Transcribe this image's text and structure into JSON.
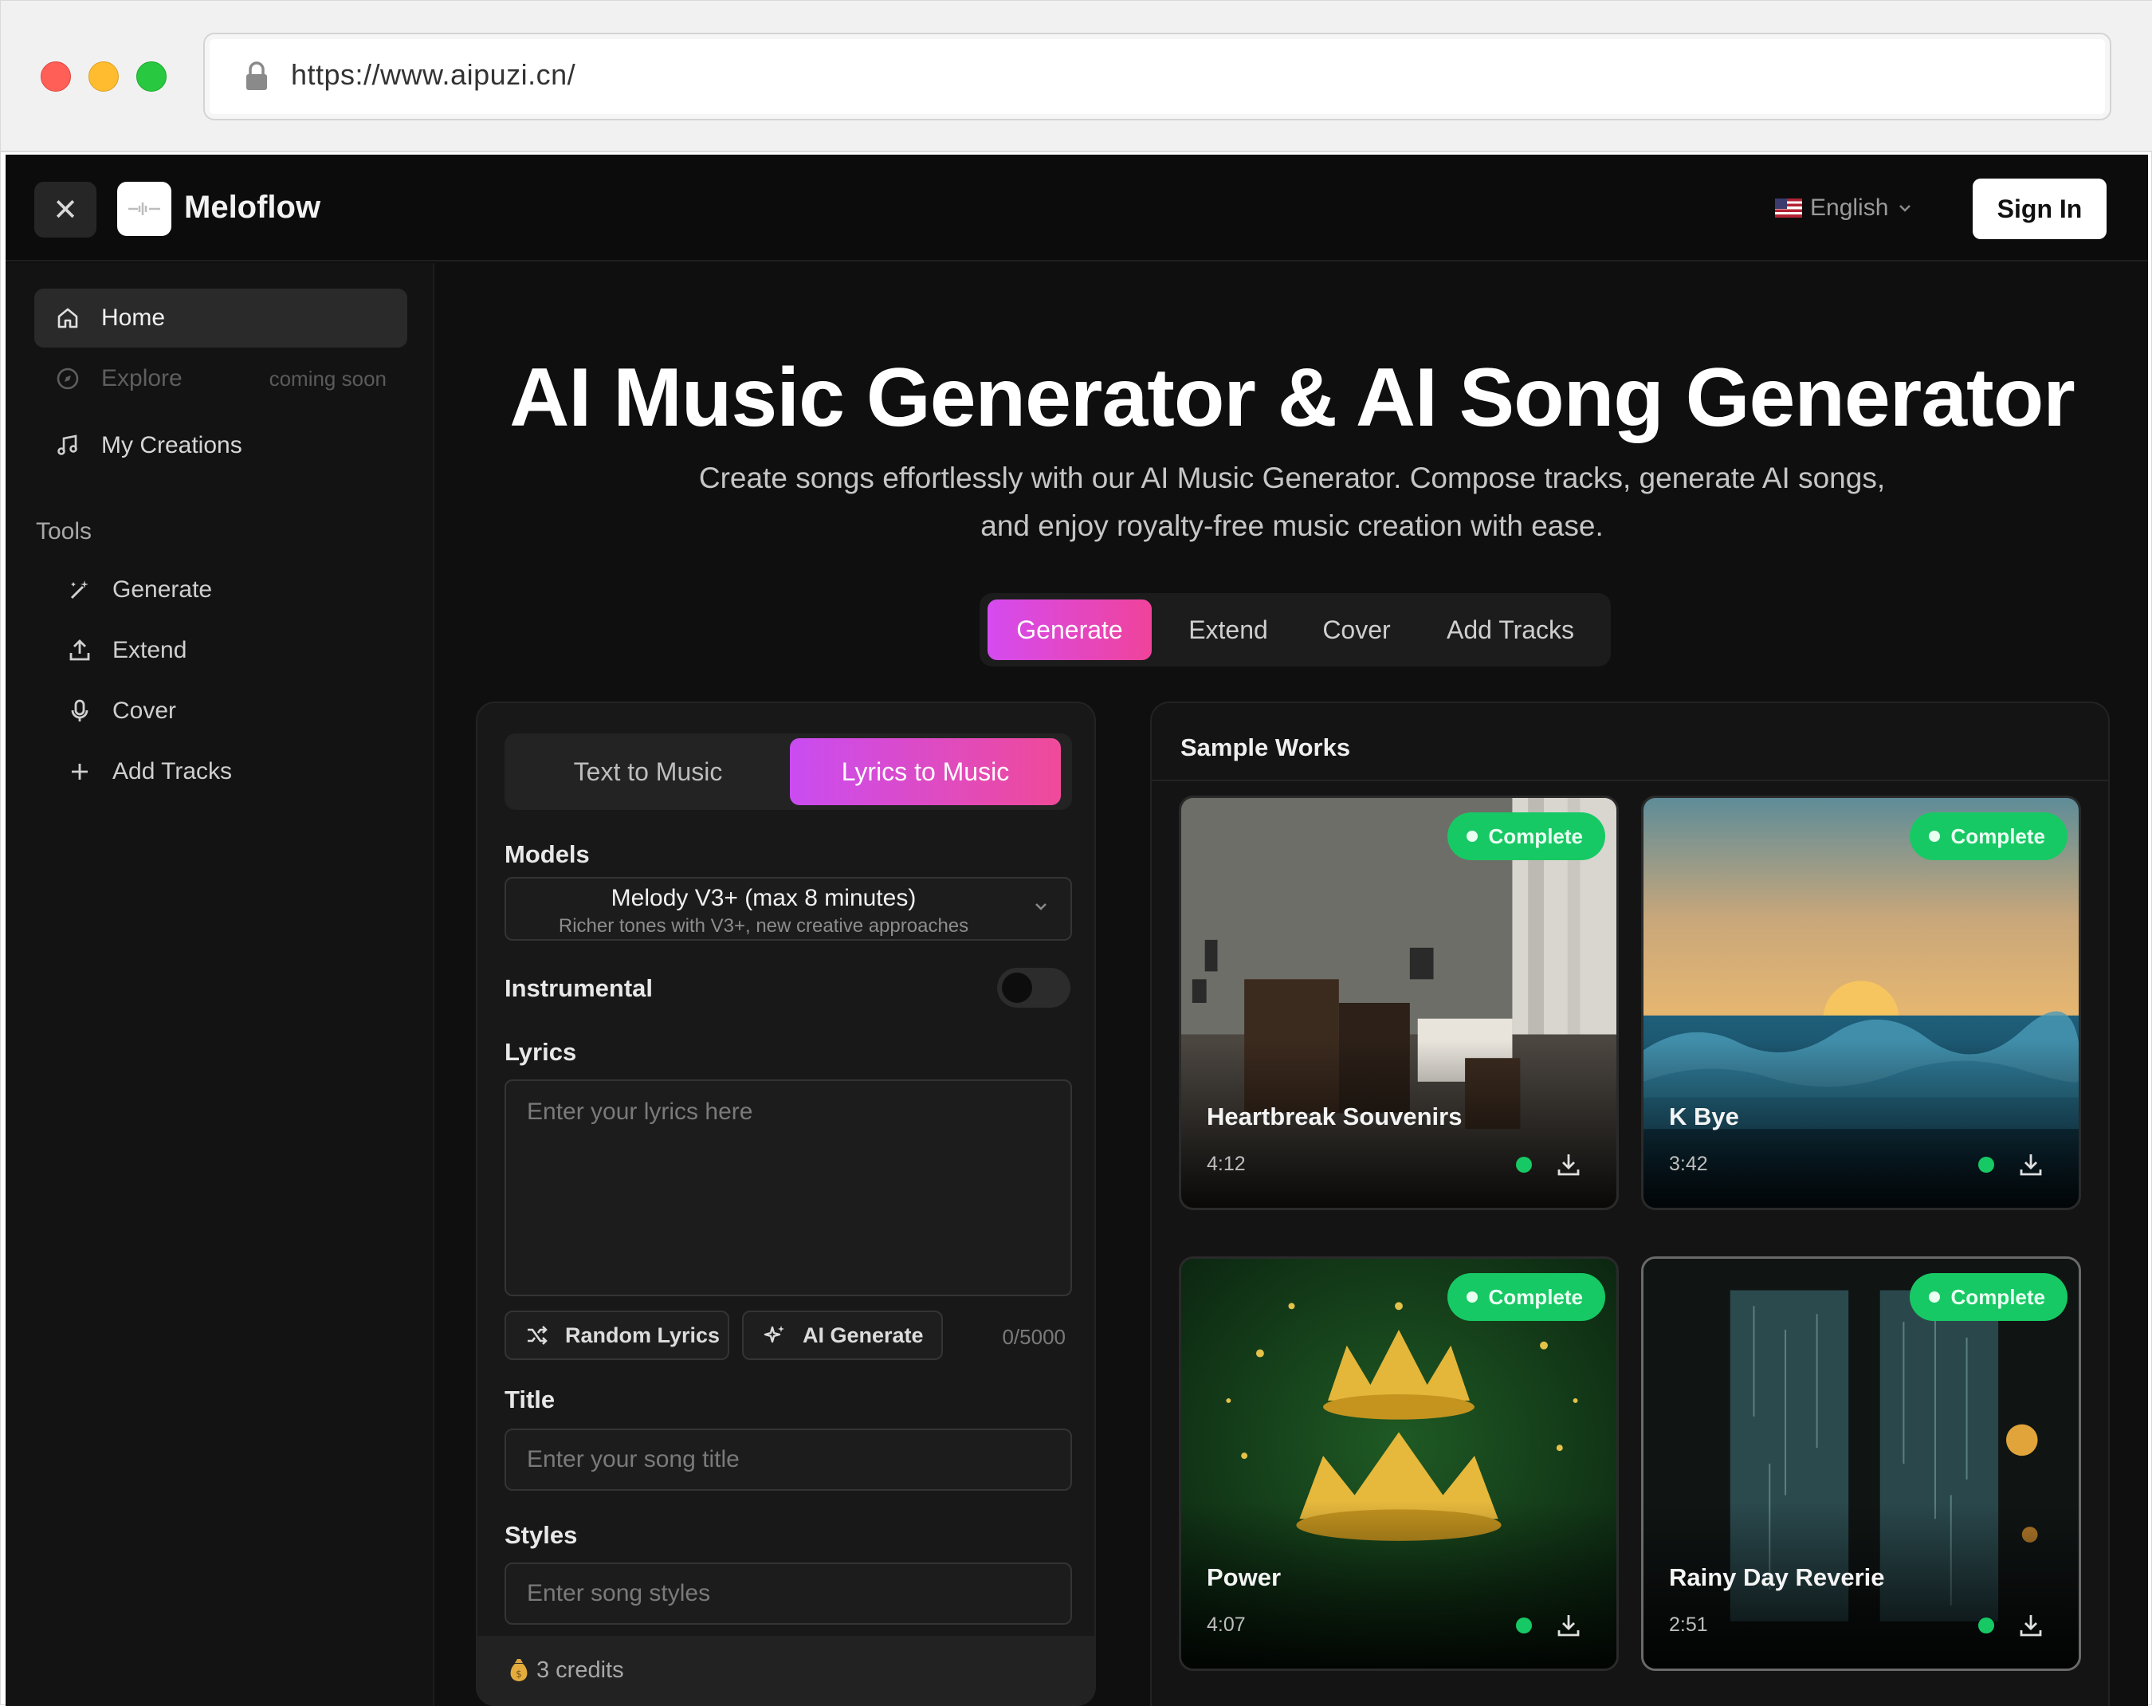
{
  "browser": {
    "url": "https://www.aipuzi.cn/"
  },
  "topbar": {
    "close_icon": "close-icon",
    "brand": "Meloflow",
    "language": "English",
    "sign_in": "Sign In"
  },
  "sidebar": {
    "items": [
      {
        "label": "Home",
        "icon": "home-icon",
        "active": true
      },
      {
        "label": "Explore",
        "icon": "compass-icon",
        "badge": "coming soon"
      },
      {
        "label": "My Creations",
        "icon": "music-note-icon"
      }
    ],
    "tools_header": "Tools",
    "tools": [
      {
        "label": "Generate",
        "icon": "magic-wand-icon"
      },
      {
        "label": "Extend",
        "icon": "upload-icon"
      },
      {
        "label": "Cover",
        "icon": "microphone-icon"
      },
      {
        "label": "Add Tracks",
        "icon": "plus-icon"
      }
    ]
  },
  "hero": {
    "title": "AI Music Generator & AI Song Generator",
    "subtitle_line1": "Create songs effortlessly with our AI Music Generator. Compose tracks, generate AI songs,",
    "subtitle_line2": "and enjoy royalty-free music creation with ease."
  },
  "mode_tabs": [
    {
      "label": "Generate",
      "active": true
    },
    {
      "label": "Extend"
    },
    {
      "label": "Cover"
    },
    {
      "label": "Add Tracks"
    }
  ],
  "form": {
    "sub_tabs": [
      {
        "label": "Text to Music"
      },
      {
        "label": "Lyrics to Music",
        "active": true
      }
    ],
    "models_label": "Models",
    "model_name": "Melody V3+ (max 8 minutes)",
    "model_desc": "Richer tones with V3+, new creative approaches",
    "instrumental_label": "Instrumental",
    "instrumental_on": false,
    "lyrics_label": "Lyrics",
    "lyrics_placeholder": "Enter your lyrics here",
    "random_lyrics": "Random Lyrics",
    "ai_generate": "AI Generate",
    "char_count": "0/5000",
    "title_label": "Title",
    "title_placeholder": "Enter your song title",
    "styles_label": "Styles",
    "styles_placeholder": "Enter song styles",
    "credits": "3 credits"
  },
  "samples": {
    "header": "Sample Works",
    "cards": [
      {
        "title": "Heartbreak Souvenirs",
        "duration": "4:12",
        "status": "Complete"
      },
      {
        "title": "K Bye",
        "duration": "3:42",
        "status": "Complete"
      },
      {
        "title": "Power",
        "duration": "4:07",
        "status": "Complete"
      },
      {
        "title": "Rainy Day Reverie",
        "duration": "2:51",
        "status": "Complete"
      }
    ]
  },
  "colors": {
    "accent_start": "#d54bf0",
    "accent_end": "#f0439a",
    "status_green": "#17c964",
    "background": "#0f0f10"
  }
}
